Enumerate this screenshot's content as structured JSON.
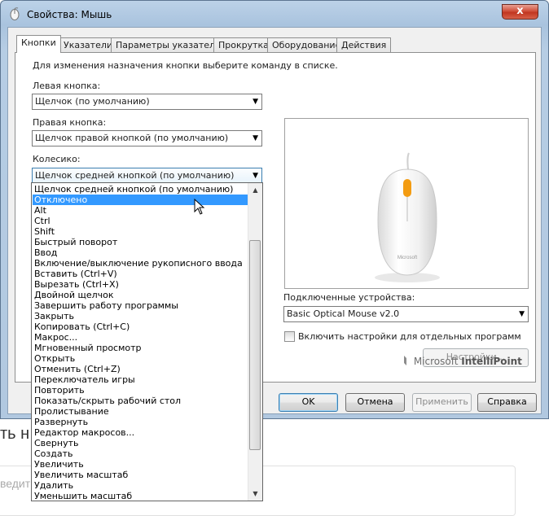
{
  "window": {
    "title": "Свойства: Мышь",
    "close_glyph": "x"
  },
  "tabs": [
    {
      "label": "Кнопки",
      "active": true
    },
    {
      "label": "Указатели"
    },
    {
      "label": "Параметры указателя"
    },
    {
      "label": "Прокрутка"
    },
    {
      "label": "Оборудование"
    },
    {
      "label": "Действия"
    }
  ],
  "panel": {
    "instruction": "Для изменения назначения кнопки выберите команду в списке.",
    "left_button": {
      "label": "Левая кнопка:",
      "value": "Щелчок (по умолчанию)"
    },
    "right_button": {
      "label": "Правая кнопка:",
      "value": "Щелчок правой кнопкой (по умолчанию)"
    },
    "wheel": {
      "label": "Колесико:",
      "value": "Щелчок средней кнопкой (по умолчанию)"
    },
    "devices": {
      "label": "Подключенные устройства:",
      "value": "Basic Optical Mouse v2.0"
    },
    "per_program_checkbox": {
      "label": "Включить настройки для отдельных программ",
      "checked": false
    },
    "settings_button": "Настройки...",
    "brand": {
      "prefix": "Microsoft",
      "product": "IntelliPoint"
    },
    "mouse_image_label": "Microsoft"
  },
  "dialog_buttons": {
    "ok": "OK",
    "cancel": "Отмена",
    "apply": "Применить",
    "help": "Справка"
  },
  "dropdown": {
    "selected_index": 1,
    "items": [
      "Щелчок средней кнопкой (по умолчанию)",
      "Отключено",
      "Alt",
      "Ctrl",
      "Shift",
      "Быстрый поворот",
      "Ввод",
      "Включение/выключение рукописного ввода",
      "Вставить (Ctrl+V)",
      "Вырезать (Ctrl+X)",
      "Двойной щелчок",
      "Завершить работу программы",
      "Закрыть",
      "Копировать (Ctrl+C)",
      "Макрос...",
      "Мгновенный просмотр",
      "Открыть",
      "Отменить (Ctrl+Z)",
      "Переключатель игры",
      "Повторить",
      "Показать/скрыть рабочий стол",
      "Пролистывание",
      "Развернуть",
      "Редактор макросов...",
      "Свернуть",
      "Создать",
      "Увеличить",
      "Увеличить масштаб",
      "Удалить",
      "Уменьшить масштаб"
    ]
  },
  "background": {
    "heading_fragment": "ть н",
    "input_fragment": "ведит"
  },
  "colors": {
    "selection": "#3399ff",
    "mouse_wheel": "#f39c12",
    "close_button": "#c13620"
  }
}
